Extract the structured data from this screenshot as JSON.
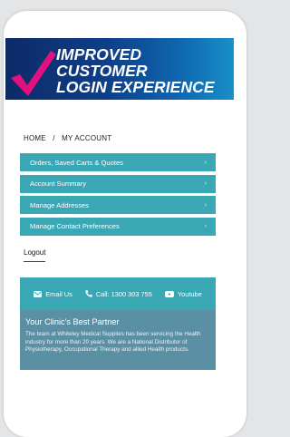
{
  "banner": {
    "headline_line1": "IMPROVED CUSTOMER",
    "headline_line2": "LOGIN EXPERIENCE",
    "check_color": "#e1127f"
  },
  "breadcrumb": {
    "home": "HOME",
    "separator": "/",
    "current": "MY ACCOUNT"
  },
  "account_menu": {
    "items": [
      {
        "label": "Orders, Saved Carts & Quotes"
      },
      {
        "label": "Account Summary"
      },
      {
        "label": "Manage Addresses"
      },
      {
        "label": "Manage Contact Preferences"
      }
    ],
    "chevron_icon": "chevron-right-icon"
  },
  "logout_label": "Logout",
  "footer": {
    "email_label": "Email Us",
    "call_label": "Call: 1300 303 755",
    "youtube_label": "Youtube",
    "about_title": "Your Clinic's Best Partner",
    "about_text": "The team at Whiteley Medical Supplies has been servicing the Health industry for more than 20 years. We are a National Distributor of Physiotherapy, Occupational Therapy and allied Health products."
  },
  "colors": {
    "accent_teal": "#3aa7b5",
    "about_bg": "#5b8fa3",
    "banner_navy": "#0d2a66"
  }
}
